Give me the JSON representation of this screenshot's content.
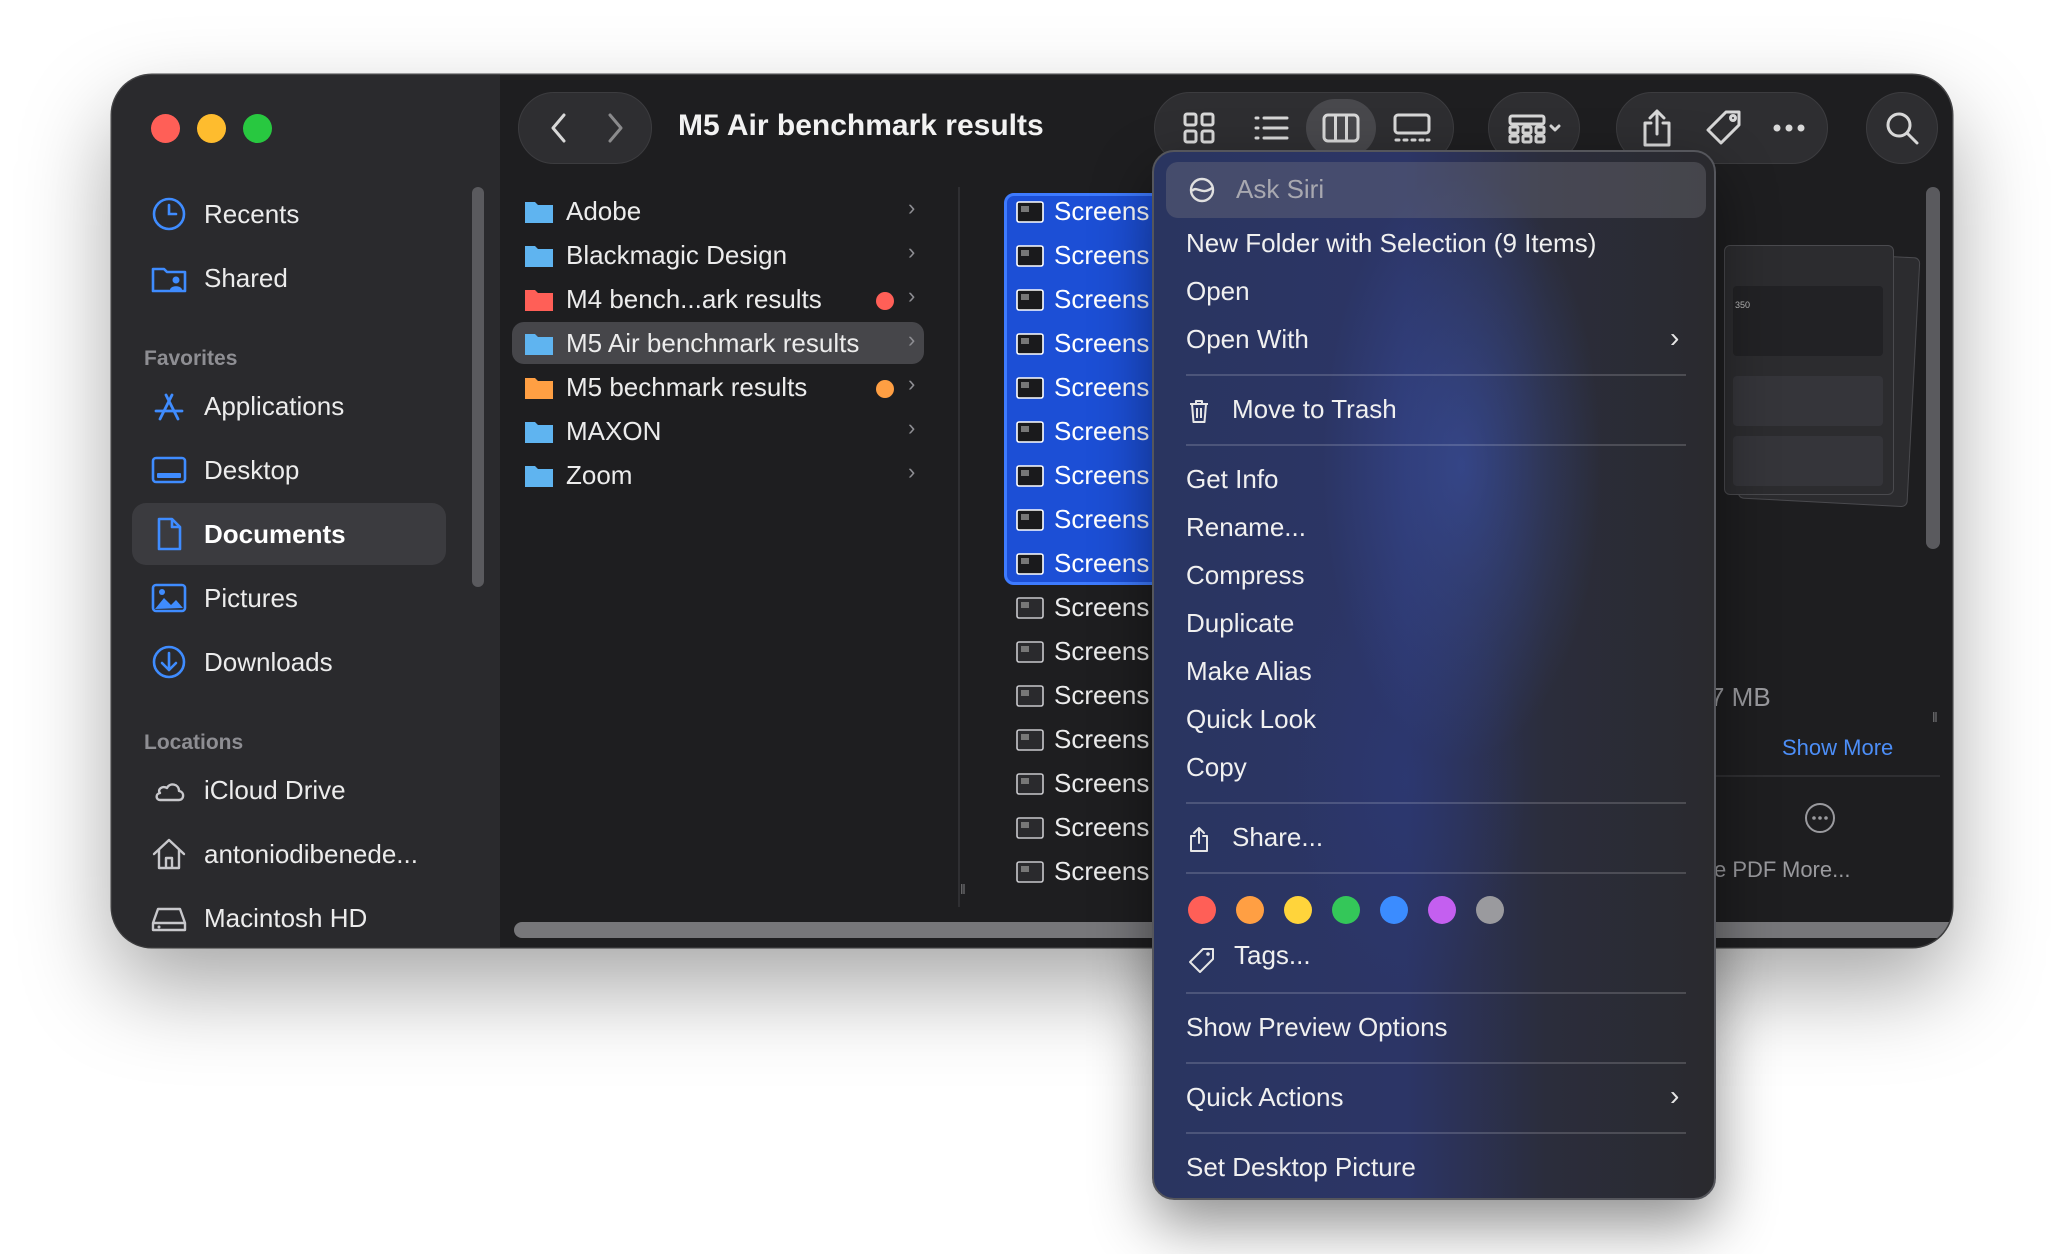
{
  "window": {
    "title": "M5 Air benchmark results"
  },
  "sidebar": {
    "items": [
      {
        "label": "Recents",
        "icon": "clock-icon"
      },
      {
        "label": "Shared",
        "icon": "shared-folder-icon"
      }
    ],
    "favorites_header": "Favorites",
    "favorites": [
      {
        "label": "Applications",
        "icon": "applications-icon"
      },
      {
        "label": "Desktop",
        "icon": "desktop-icon"
      },
      {
        "label": "Documents",
        "icon": "document-icon",
        "active": true
      },
      {
        "label": "Pictures",
        "icon": "pictures-icon"
      },
      {
        "label": "Downloads",
        "icon": "downloads-icon"
      }
    ],
    "locations_header": "Locations",
    "locations": [
      {
        "label": "iCloud Drive",
        "icon": "cloud-icon"
      },
      {
        "label": "antoniodibenede...",
        "icon": "home-icon"
      },
      {
        "label": "Macintosh HD",
        "icon": "disk-icon"
      }
    ]
  },
  "folders": [
    {
      "label": "Adobe",
      "color": "#5fb4f0",
      "tag": null
    },
    {
      "label": "Blackmagic Design",
      "color": "#5fb4f0",
      "tag": null
    },
    {
      "label": "M4 bench...ark results",
      "color": "#ff5f57",
      "tag": "#ff5f57"
    },
    {
      "label": "M5 Air benchmark results",
      "color": "#5fb4f0",
      "tag": null,
      "selected": true
    },
    {
      "label": "M5 bechmark results",
      "color": "#ff9f43",
      "tag": "#ff9f43"
    },
    {
      "label": "MAXON",
      "color": "#5fb4f0",
      "tag": null
    },
    {
      "label": "Zoom",
      "color": "#5fb4f0",
      "tag": null
    }
  ],
  "files": {
    "label": "Screens",
    "selected_count": 9,
    "unselected_count": 7
  },
  "preview": {
    "size_text": "7 MB",
    "show_more": "Show More",
    "pdf_label": "e PDF",
    "more_label": "More...",
    "thumb_text": "350"
  },
  "context_menu": {
    "ask_siri": "Ask Siri",
    "new_folder": "New Folder with Selection (9 Items)",
    "open": "Open",
    "open_with": "Open With",
    "move_to_trash": "Move to Trash",
    "get_info": "Get Info",
    "rename": "Rename...",
    "compress": "Compress",
    "duplicate": "Duplicate",
    "make_alias": "Make Alias",
    "quick_look": "Quick Look",
    "copy": "Copy",
    "share": "Share...",
    "tags": "Tags...",
    "show_preview_options": "Show Preview Options",
    "quick_actions": "Quick Actions",
    "set_desktop_picture": "Set Desktop Picture",
    "tag_colors": [
      "#ff5f57",
      "#ff9f43",
      "#ffd43b",
      "#34c759",
      "#3b8cff",
      "#c45ff0",
      "#9a9a9e"
    ]
  }
}
